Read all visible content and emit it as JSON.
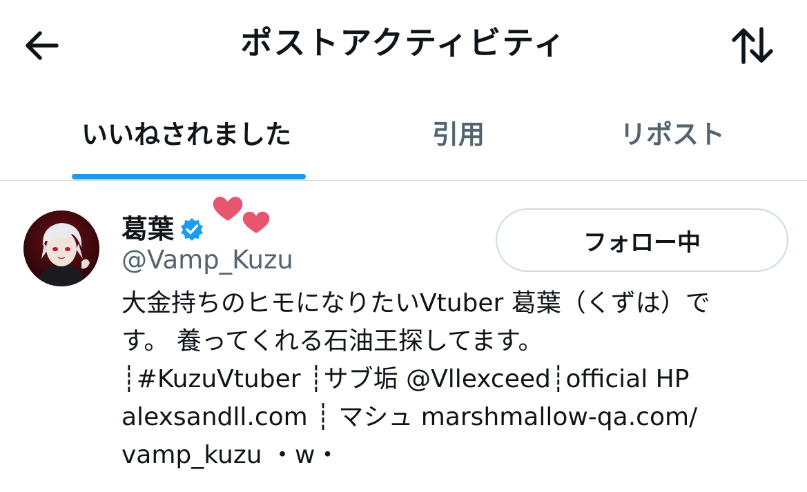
{
  "header": {
    "title": "ポストアクティビティ",
    "back_icon": "arrow-left-icon",
    "sort_icon": "sort-arrows-icon"
  },
  "tabs": [
    {
      "label": "いいねされました",
      "active": true
    },
    {
      "label": "引用",
      "active": false
    },
    {
      "label": "リポスト",
      "active": false
    }
  ],
  "colors": {
    "accent": "#1d9bf0",
    "text": "#0f1419",
    "secondary_text": "#536471",
    "border": "#cfd9de",
    "heart": "#e8556f"
  },
  "user": {
    "display_name": "葛葉",
    "handle": "@Vamp_Kuzu",
    "verified": true,
    "follow_button_label": "フォロー中",
    "bio_lines": [
      "大金持ちのヒモになりたいVtuber 葛葉（くずは）で",
      "す。 養ってくれる石油王探してます。",
      "┊#KuzuVtuber ┊サブ垢 @Vllexceed┊official HP",
      "alexsandll.com ┊ マシュ marshmallow-qa.com/",
      "vamp_kuzu ・w・"
    ]
  }
}
